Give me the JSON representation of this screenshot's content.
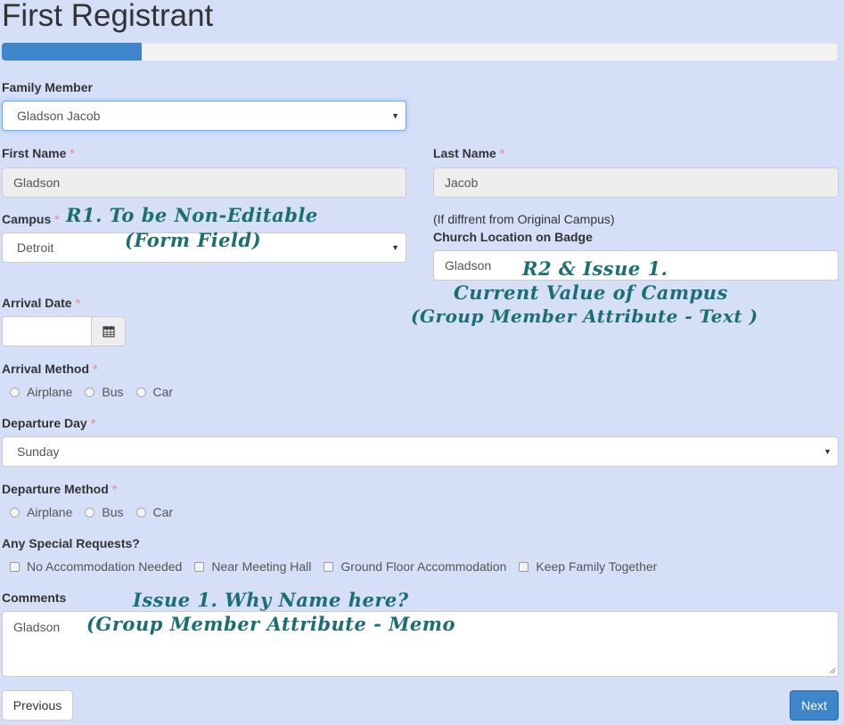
{
  "page": {
    "title": "First Registrant"
  },
  "progress": {
    "fraction": 0.167
  },
  "family_member": {
    "label": "Family Member",
    "value": "Gladson Jacob"
  },
  "first_name": {
    "label": "First Name",
    "required_mark": "*",
    "value": "Gladson"
  },
  "last_name": {
    "label": "Last Name",
    "required_mark": "*",
    "value": "Jacob"
  },
  "campus": {
    "label": "Campus",
    "required_mark": "*",
    "value": "Detroit"
  },
  "church_location": {
    "hint": "(If diffrent from Original Campus)",
    "label": "Church Location on Badge",
    "value": "Gladson"
  },
  "arrival_date": {
    "label": "Arrival Date",
    "required_mark": "*",
    "value": "",
    "icon": "calendar-icon"
  },
  "arrival_method": {
    "label": "Arrival Method",
    "required_mark": "*",
    "options": [
      "Airplane",
      "Bus",
      "Car"
    ]
  },
  "departure_day": {
    "label": "Departure Day",
    "required_mark": "*",
    "value": "Sunday"
  },
  "departure_method": {
    "label": "Departure Method",
    "required_mark": "*",
    "options": [
      "Airplane",
      "Bus",
      "Car"
    ]
  },
  "special_requests": {
    "label": "Any Special Requests?",
    "options": [
      "No Accommodation Needed",
      "Near Meeting Hall",
      "Ground Floor Accommodation",
      "Keep Family Together"
    ]
  },
  "comments": {
    "label": "Comments",
    "value": "Gladson"
  },
  "buttons": {
    "previous": "Previous",
    "next": "Next"
  },
  "annotations": {
    "r1_line1": "R1. To be Non-Editable",
    "r1_line2": "(Form Field)",
    "r2_line1": "R2 & Issue 1.",
    "r2_line2": "Current Value of Campus",
    "r2_line3": "(Group Member Attribute - Text )",
    "issue1_line1": "Issue 1. Why Name here?",
    "issue1_line2": "(Group Member Attribute - Memo"
  },
  "colors": {
    "background": "#d6dff8",
    "accent": "#3e86c9",
    "annotation": "#1b6f72",
    "required": "#e0a0a0"
  }
}
